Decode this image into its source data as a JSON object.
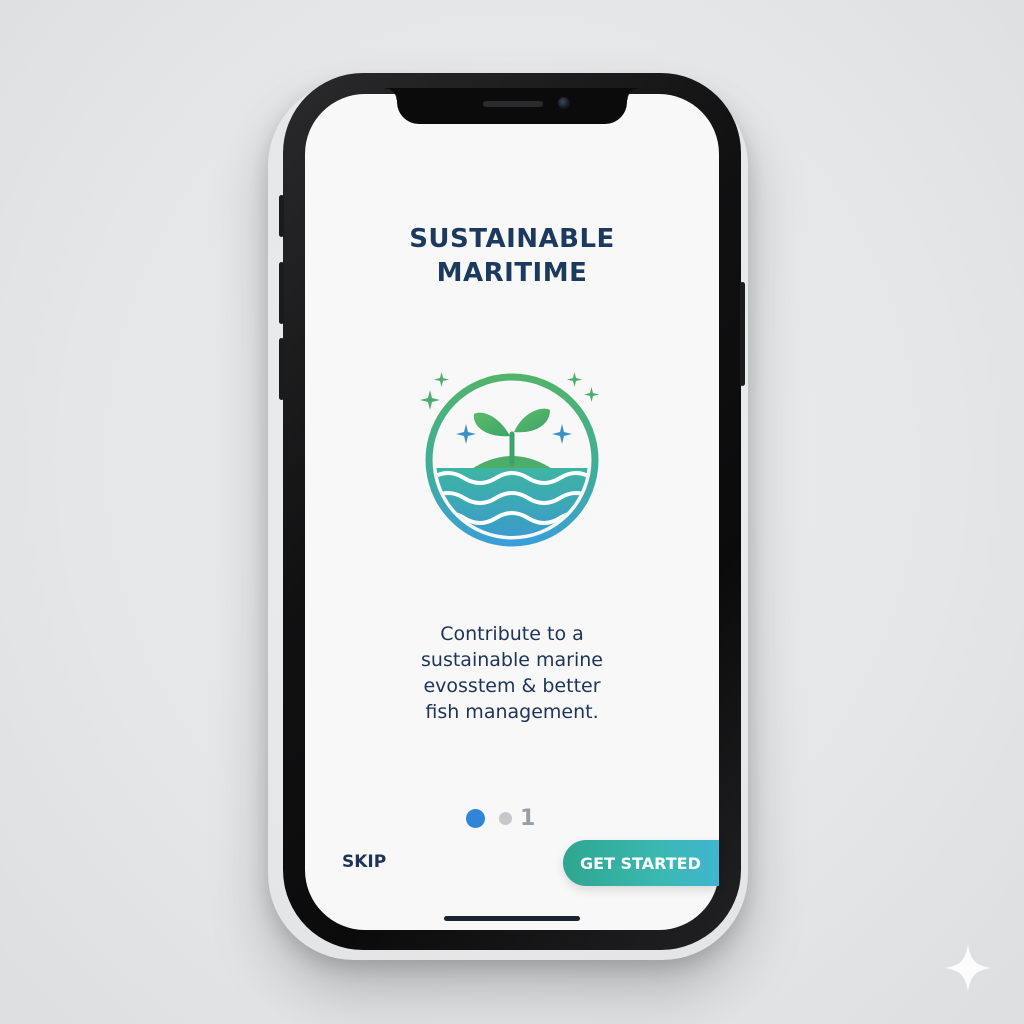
{
  "onboarding": {
    "title": "SUSTAINABLE\nMARITIME",
    "description": "Contribute to a\nsustainable marine\nevosstem & better\nfish management.",
    "pager": {
      "active_index": 0,
      "label": "1"
    },
    "skip_label": "SKIP",
    "get_started_label": "GET STARTED"
  },
  "icons": {
    "logo": "sprout-over-waves-icon",
    "sparkle": "sparkle-icon",
    "watermark": "four-point-star-icon"
  },
  "colors": {
    "title": "#1c3a5e",
    "accent_green": "#4cae6a",
    "accent_blue": "#2f86d8",
    "button_gradient_start": "#2ea68f",
    "button_gradient_end": "#3fb6cf"
  }
}
